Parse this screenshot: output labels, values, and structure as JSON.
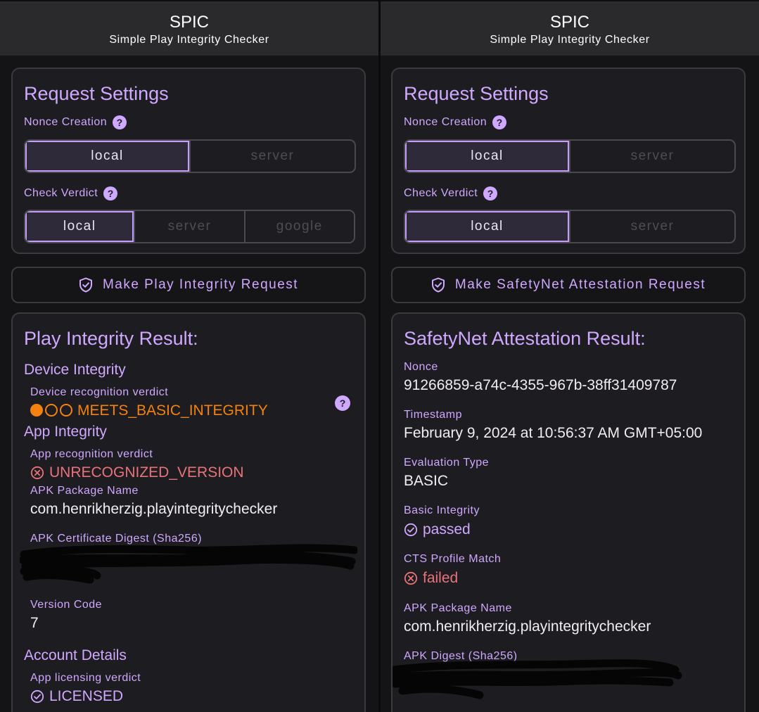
{
  "left": {
    "app_title": "SPIC",
    "app_subtitle": "Simple Play Integrity Checker",
    "settings_title": "Request Settings",
    "nonce_label": "Nonce Creation",
    "nonce_options": [
      "local",
      "server"
    ],
    "verdict_label": "Check Verdict",
    "verdict_options": [
      "local",
      "server",
      "google"
    ],
    "request_button": "Make Play Integrity Request",
    "result_title": "Play Integrity Result:",
    "device_integrity_title": "Device Integrity",
    "device_verdict_label": "Device recognition verdict",
    "device_verdict_value": "MEETS_BASIC_INTEGRITY",
    "app_integrity_title": "App Integrity",
    "app_verdict_label": "App recognition verdict",
    "app_verdict_value": "UNRECOGNIZED_VERSION",
    "package_label": "APK Package Name",
    "package_value": "com.henrikherzig.playintegritychecker",
    "cert_label": "APK Certificate Digest (Sha256)",
    "version_label": "Version Code",
    "version_value": "7",
    "account_title": "Account Details",
    "licensing_label": "App licensing verdict",
    "licensing_value": "LICENSED"
  },
  "right": {
    "app_title": "SPIC",
    "app_subtitle": "Simple Play Integrity Checker",
    "settings_title": "Request Settings",
    "nonce_label": "Nonce Creation",
    "nonce_options": [
      "local",
      "server"
    ],
    "verdict_label": "Check Verdict",
    "verdict_options": [
      "local",
      "server"
    ],
    "request_button": "Make SafetyNet Attestation Request",
    "result_title": "SafetyNet Attestation Result:",
    "nonce_field_label": "Nonce",
    "nonce_value": "91266859-a74c-4355-967b-38ff31409787",
    "timestamp_label": "Timestamp",
    "timestamp_value": "February 9, 2024 at 10:56:37 AM GMT+05:00",
    "eval_label": "Evaluation Type",
    "eval_value": "BASIC",
    "basic_label": "Basic Integrity",
    "basic_value": "passed",
    "cts_label": "CTS Profile Match",
    "cts_value": "failed",
    "package_label": "APK Package Name",
    "package_value": "com.henrikherzig.playintegritychecker",
    "digest_label": "APK Digest (Sha256)"
  },
  "colors": {
    "accent": "#cfa8ff",
    "warning": "#f5820e",
    "error": "#e9737a",
    "background": "#141316",
    "card": "#1d1c20"
  },
  "icons": [
    "help-icon",
    "shield-check-icon",
    "circle-x-icon",
    "circle-check-icon"
  ],
  "device_integrity_level": "1 of 3"
}
